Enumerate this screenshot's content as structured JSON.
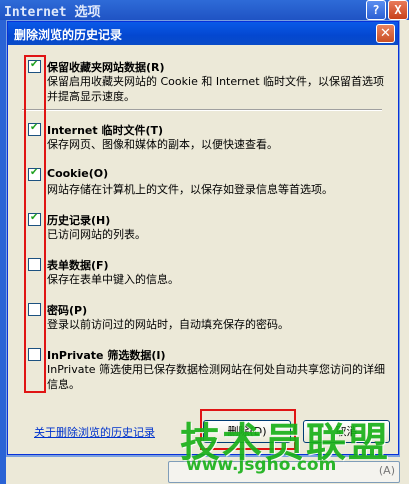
{
  "background_window": {
    "title": "Internet 选项",
    "help_label": "?",
    "close_label": "X",
    "button_hint": "(A)"
  },
  "dialog": {
    "title": "删除浏览的历史记录",
    "close_label": "✕",
    "options": [
      {
        "label": "保留收藏夹网站数据(R)",
        "description": "保留启用收藏夹网站的 Cookie 和 Internet 临时文件，以保留首选项并提高显示速度。",
        "checked": true
      },
      {
        "label": "Internet 临时文件(T)",
        "description": "保存网页、图像和媒体的副本，以便快速查看。",
        "checked": true
      },
      {
        "label": "Cookie(O)",
        "description": "网站存储在计算机上的文件，以保存如登录信息等首选项。",
        "checked": true
      },
      {
        "label": "历史记录(H)",
        "description": "已访问网站的列表。",
        "checked": true
      },
      {
        "label": "表单数据(F)",
        "description": "保存在表单中键入的信息。",
        "checked": false
      },
      {
        "label": "密码(P)",
        "description": "登录以前访问过的网站时，自动填充保存的密码。",
        "checked": false
      },
      {
        "label": "InPrivate 筛选数据(I)",
        "description": "InPrivate 筛选使用已保存数据检测网站在何处自动共享您访问的详细信息。",
        "checked": false
      }
    ],
    "about_link": "关于删除浏览的历史记录",
    "delete_button": "删除(D)",
    "cancel_button": "取消"
  },
  "watermark": {
    "text": "技术员联盟",
    "url": "www.jsgho.com"
  },
  "colors": {
    "title_bar": "#0a5ae8",
    "dialog_bg": "#ece9d8",
    "highlight_red": "#e01414",
    "check_green": "#21a121",
    "watermark_green": "#1ab11a"
  }
}
